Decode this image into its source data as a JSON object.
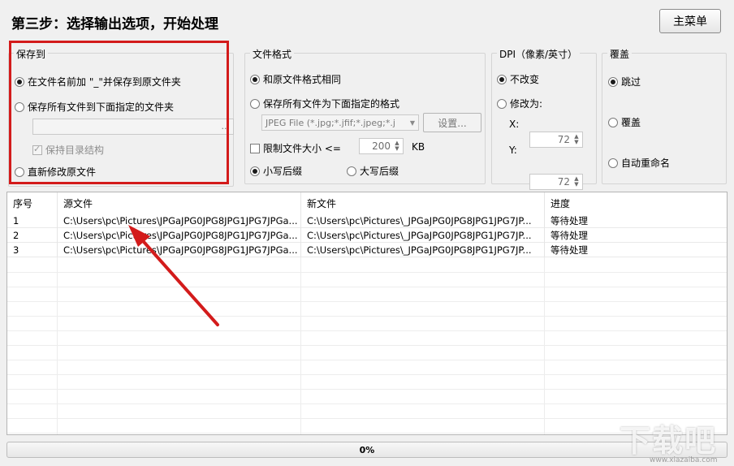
{
  "header": {
    "title": "第三步：选择输出选项，开始处理",
    "main_menu_label": "主菜单"
  },
  "save_to": {
    "title": "保存到",
    "option_prefix": "在文件名前加 \"_\"并保存到原文件夹",
    "option_folder": "保存所有文件到下面指定的文件夹",
    "folder_path": "",
    "browse_label": "...",
    "keep_structure": "保持目录结构",
    "option_overwrite": "直新修改原文件"
  },
  "format": {
    "title": "文件格式",
    "option_same": "和原文件格式相同",
    "option_specified": "保存所有文件为下面指定的格式",
    "format_select": "JPEG File (*.jpg;*.jfif;*.jpeg;*.j",
    "settings_label": "设置...",
    "limit_size_label": "限制文件大小 <=",
    "limit_size_value": "200",
    "limit_size_unit": "KB",
    "lowercase_ext": "小写后缀",
    "uppercase_ext": "大写后缀"
  },
  "dpi": {
    "title": "DPI（像素/英寸）",
    "option_keep": "不改变",
    "option_change": "修改为:",
    "x_label": "X:",
    "x_value": "72",
    "y_label": "Y:",
    "y_value": "72"
  },
  "overwrite": {
    "title": "覆盖",
    "option_skip": "跳过",
    "option_overwrite": "覆盖",
    "option_rename": "自动重命名"
  },
  "table": {
    "columns": [
      "序号",
      "源文件",
      "新文件",
      "进度"
    ],
    "rows": [
      [
        "1",
        "C:\\Users\\pc\\Pictures\\JPGaJPG0JPG8JPG1JPG7JPGa...",
        "C:\\Users\\pc\\Pictures\\_JPGaJPG0JPG8JPG1JPG7JP...",
        "等待处理"
      ],
      [
        "2",
        "C:\\Users\\pc\\Pictures\\JPGaJPG0JPG8JPG1JPG7JPGa...",
        "C:\\Users\\pc\\Pictures\\_JPGaJPG0JPG8JPG1JPG7JP...",
        "等待处理"
      ],
      [
        "3",
        "C:\\Users\\pc\\Pictures\\JPGaJPG0JPG8JPG1JPG7JPGa...",
        "C:\\Users\\pc\\Pictures\\_JPGaJPG0JPG8JPG1JPG7JP...",
        "等待处理"
      ]
    ]
  },
  "progress": {
    "label": "0%",
    "value": 0
  },
  "watermark": {
    "text": "下载吧",
    "sub": "www.xiazaiba.com"
  },
  "colors": {
    "highlight": "#d31b1b",
    "arrow": "#d31b1b"
  }
}
